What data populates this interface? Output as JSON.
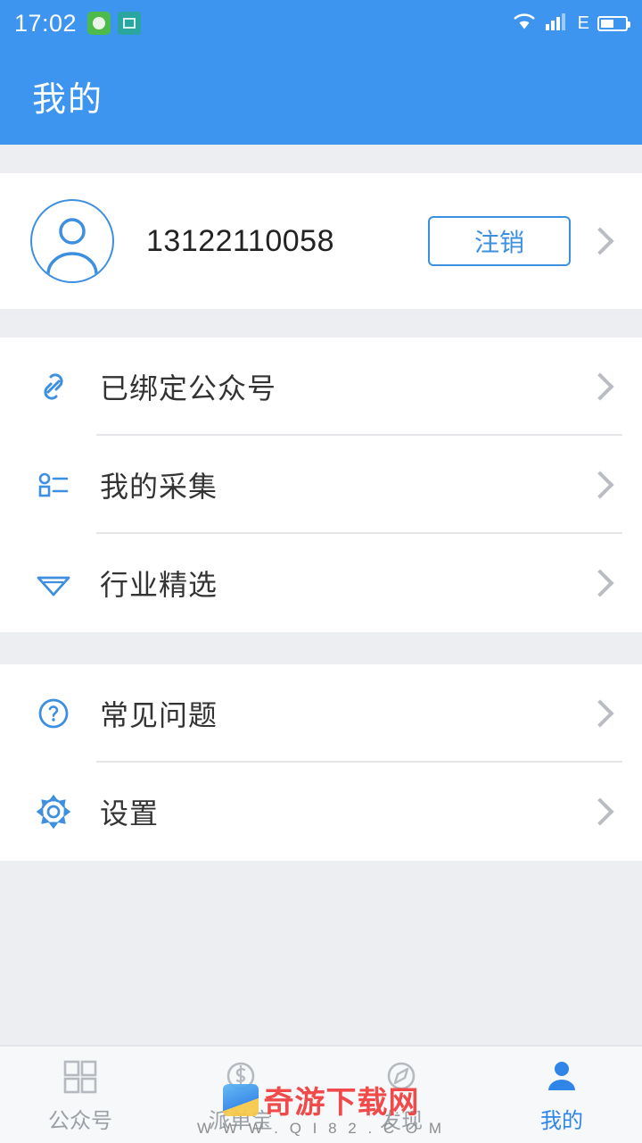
{
  "status_bar": {
    "time": "17:02",
    "carrier_letter": "E",
    "icons": [
      "green-app-icon",
      "teal-app-icon",
      "wifi-icon",
      "signal-icon",
      "battery-icon"
    ]
  },
  "header": {
    "title": "我的"
  },
  "profile": {
    "avatar_icon": "user-avatar-icon",
    "phone": "13122110058",
    "logout_label": "注销",
    "chevron_icon": "chevron-right-icon"
  },
  "menu_groups": [
    {
      "items": [
        {
          "icon": "link-icon",
          "label": "已绑定公众号"
        },
        {
          "icon": "collection-icon",
          "label": "我的采集"
        },
        {
          "icon": "diamond-icon",
          "label": "行业精选"
        }
      ]
    },
    {
      "items": [
        {
          "icon": "question-circle-icon",
          "label": "常见问题"
        },
        {
          "icon": "gear-icon",
          "label": "设置"
        }
      ]
    }
  ],
  "tabbar": {
    "items": [
      {
        "icon": "grid-icon",
        "label": "公众号",
        "active": false
      },
      {
        "icon": "money-icon",
        "label": "派单宝",
        "active": false
      },
      {
        "icon": "compass-icon",
        "label": "发现",
        "active": false
      },
      {
        "icon": "person-icon",
        "label": "我的",
        "active": true
      }
    ]
  },
  "watermark": {
    "text": "奇游下载网",
    "subtext": "W W W . Q I 8 2 . C O M"
  },
  "colors": {
    "primary": "#3d95f0",
    "accent": "#2f86e8",
    "background": "#eceef2",
    "card": "#ffffff",
    "text": "#333333"
  }
}
